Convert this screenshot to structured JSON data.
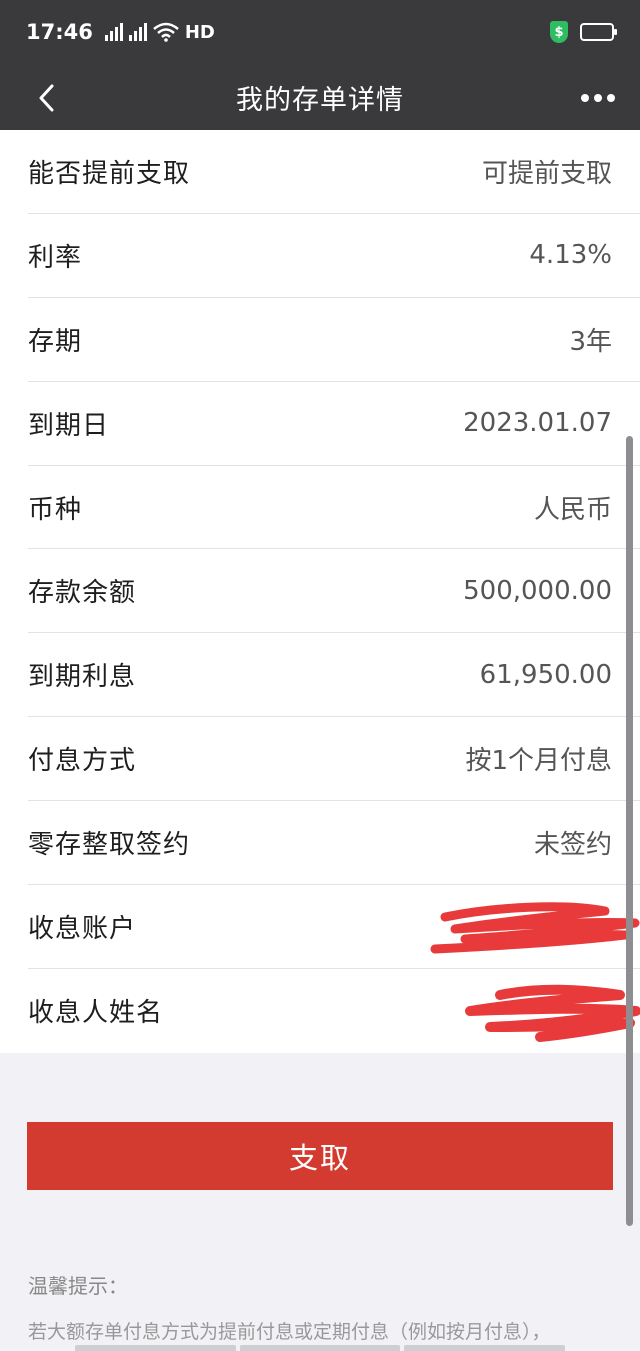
{
  "status_bar": {
    "time": "17:46",
    "network_1": "4G",
    "network_2": "4G",
    "hd_label": "HD",
    "shield_symbol": "$",
    "battery_color": "#f5d90f"
  },
  "nav": {
    "title": "我的存单详情",
    "back_icon": "chevron-left-icon",
    "more_icon": "more-horizontal-icon"
  },
  "details": [
    {
      "label": "能否提前支取",
      "value": "可提前支取"
    },
    {
      "label": "利率",
      "value": "4.13%"
    },
    {
      "label": "存期",
      "value": "3年"
    },
    {
      "label": "到期日",
      "value": "2023.01.07"
    },
    {
      "label": "币种",
      "value": "人民币"
    },
    {
      "label": "存款余额",
      "value": "500,000.00"
    },
    {
      "label": "到期利息",
      "value": "61,950.00"
    },
    {
      "label": "付息方式",
      "value": "按1个月付息"
    },
    {
      "label": "零存整取签约",
      "value": "未签约"
    },
    {
      "label": "收息账户",
      "value": ""
    },
    {
      "label": "收息人姓名",
      "value": ""
    }
  ],
  "action": {
    "withdraw_label": "支取",
    "accent_color": "#d33b30"
  },
  "tips": {
    "title": "温馨提示：",
    "text": "若大额存单付息方式为提前付息或定期付息（例如按月付息），"
  }
}
